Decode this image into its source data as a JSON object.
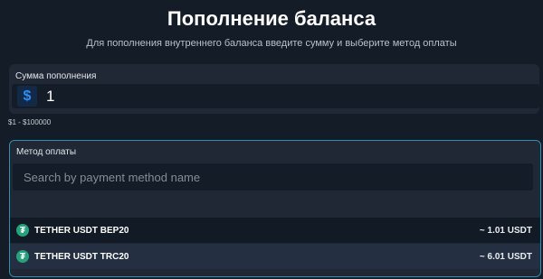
{
  "header": {
    "title": "Пополнение баланса",
    "subtitle": "Для пополнения внутреннего баланса введите сумму и выберите метод оплаты"
  },
  "amount": {
    "label": "Сумма пополнения",
    "currency_symbol": "$",
    "value": "1",
    "range": "$1 - $100000"
  },
  "payment": {
    "label": "Метод оплаты",
    "search_placeholder": "Search by payment method name",
    "methods": [
      {
        "name": "TETHER USDT BEP20",
        "price": "~ 1.01 USDT",
        "icon": "tether-icon",
        "icon_glyph": "₮"
      },
      {
        "name": "TETHER USDT TRC20",
        "price": "~ 6.01 USDT",
        "icon": "tether-icon",
        "icon_glyph": "₮"
      }
    ]
  },
  "colors": {
    "background": "#141c27",
    "card": "#1f2834",
    "accent": "#2f8df5",
    "focus_border": "#2f8fb2",
    "tether": "#26a17b"
  }
}
